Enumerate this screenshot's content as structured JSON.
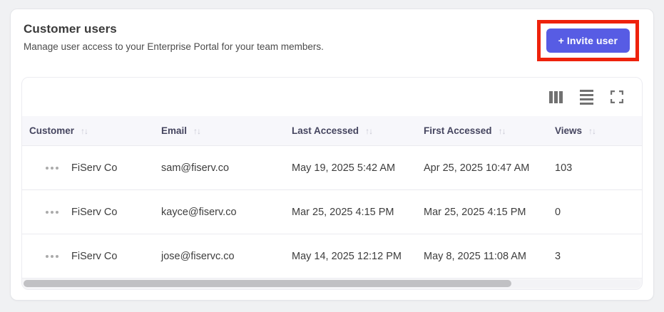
{
  "page": {
    "title": "Customer users",
    "subtitle": "Manage user access to your Enterprise Portal for your team members."
  },
  "header": {
    "invite_button_label": "+ Invite user"
  },
  "toolbar": {
    "icons": [
      "columns-icon",
      "row-density-icon",
      "fullscreen-icon"
    ]
  },
  "table": {
    "sort_glyph": "↑↓",
    "columns": [
      {
        "label": "Customer",
        "sortable": true
      },
      {
        "label": "Email",
        "sortable": true
      },
      {
        "label": "Last Accessed",
        "sortable": true
      },
      {
        "label": "First Accessed",
        "sortable": true
      },
      {
        "label": "Views",
        "sortable": true
      }
    ],
    "rows": [
      {
        "customer": "FiServ Co",
        "email": "sam@fiserv.co",
        "last_accessed": "May 19, 2025 5:42 AM",
        "first_accessed": "Apr 25, 2025 10:47 AM",
        "views": "103"
      },
      {
        "customer": "FiServ Co",
        "email": "kayce@fiserv.co",
        "last_accessed": "Mar 25, 2025 4:15 PM",
        "first_accessed": "Mar 25, 2025 4:15 PM",
        "views": "0"
      },
      {
        "customer": "FiServ Co",
        "email": "jose@fiservc.co",
        "last_accessed": "May 14, 2025 12:12 PM",
        "first_accessed": "May 8, 2025 11:08 AM",
        "views": "3"
      }
    ]
  },
  "colors": {
    "accent": "#575ce4",
    "annotation_highlight": "#ee220c",
    "header_row_bg": "#f7f7fb",
    "page_bg": "#f0f1f3"
  }
}
